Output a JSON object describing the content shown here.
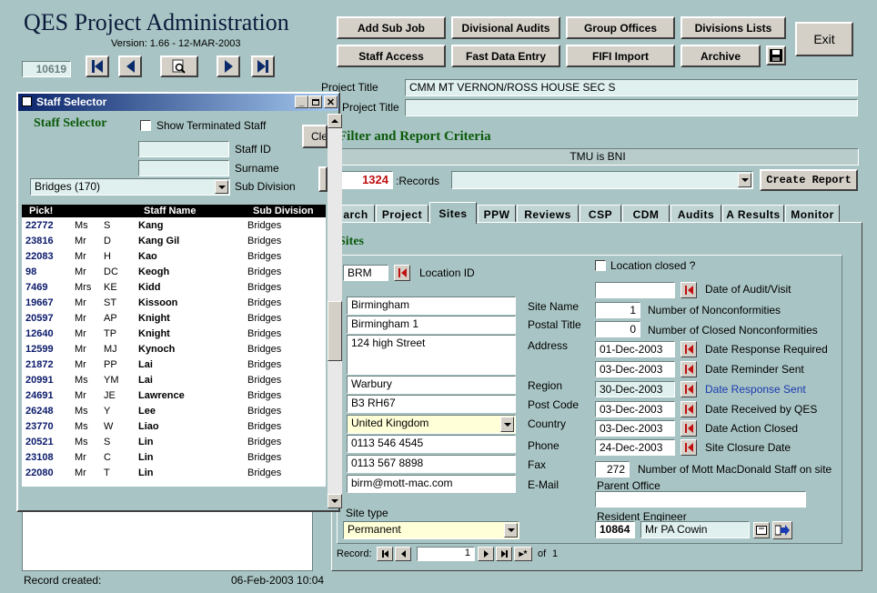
{
  "app": {
    "title": "QES Project Administration",
    "version": "Version: 1.66 - 12-MAR-2003",
    "record_no": "10619"
  },
  "toolbar": {
    "add_sub_job": "Add Sub Job",
    "divisional_audits": "Divisional Audits",
    "group_offices": "Group Offices",
    "divisions_lists": "Divisions Lists",
    "exit": "Exit",
    "staff_access": "Staff Access",
    "fast_data_entry": "Fast Data Entry",
    "fifi_import": "FIFI Import",
    "archive": "Archive"
  },
  "project": {
    "title_label": "Project Title",
    "title_value": "CMM MT VERNON/ROSS HOUSE SEC S",
    "sub_title_label": "Project Title",
    "sub_title_value": ""
  },
  "filter": {
    "heading": "Filter and Report Criteria",
    "criteria": "TMU is BNI",
    "records_count": "1324",
    "records_label": ":Records",
    "create_report": "Create Report"
  },
  "tabs": [
    "arch",
    "Project",
    "Sites",
    "PPW",
    "Reviews",
    "CSP",
    "CDM",
    "Audits",
    "A Results",
    "Monitor"
  ],
  "sites": {
    "heading": "Sites",
    "location_id_value": "BRM",
    "location_id_label": "Location ID",
    "location_closed_label": "Location closed ?",
    "site_name": "Birmingham",
    "postal_title": "Birmingham 1",
    "address": "124 high Street",
    "region": "Warbury",
    "post_code": "B3 RH67",
    "country": "United Kingdom",
    "phone": "0113 546 4545",
    "fax": "0113 567 8898",
    "email": "birm@mott-mac.com",
    "labels": {
      "site_name": "Site Name",
      "postal_title": "Postal Title",
      "address": "Address",
      "region": "Region",
      "post_code": "Post Code",
      "country": "Country",
      "phone": "Phone",
      "fax": "Fax",
      "email": "E-Mail",
      "site_type": "Site type",
      "parent_office": "Parent Office",
      "resident_engineer": "Resident Engineer"
    },
    "site_type": "Permanent",
    "date_audit_label": "Date of Audit/Visit",
    "date_audit_value": "",
    "nonconf_value": "1",
    "nonconf_label": "Number of Nonconformities",
    "closed_nonconf_value": "0",
    "closed_nonconf_label": "Number of Closed Nonconformities",
    "dates": [
      {
        "value": "01-Dec-2003",
        "label": "Date Response Required"
      },
      {
        "value": "03-Dec-2003",
        "label": "Date Reminder Sent"
      },
      {
        "value": "30-Dec-2003",
        "label": "Date Response Sent"
      },
      {
        "value": "03-Dec-2003",
        "label": "Date Received by QES"
      },
      {
        "value": "03-Dec-2003",
        "label": "Date Action Closed"
      },
      {
        "value": "24-Dec-2003",
        "label": "Site Closure Date"
      }
    ],
    "staff_count": "272",
    "staff_count_label": "Number of Mott MacDonald Staff on site",
    "parent_office_value": "",
    "resident_engineer_id": "10864",
    "resident_engineer_name": "Mr PA Cowin"
  },
  "record_nav": {
    "label": "Record:",
    "current": "1",
    "of_label": "of",
    "total": "1"
  },
  "footer": {
    "created_label": "Record created:",
    "created_value": "06-Feb-2003 10:04"
  },
  "staff_selector": {
    "window_title": "Staff Selector",
    "heading": "Staff Selector",
    "show_terminated": "Show Terminated Staff",
    "clear": "Clear",
    "staff_id_label": "Staff ID",
    "surname_label": "Surname",
    "sub_division_label": "Sub Division",
    "division_value": "Bridges (170)",
    "columns": {
      "pick": "Pick!",
      "name": "Staff Name",
      "sub": "Sub Division"
    },
    "rows": [
      {
        "id": "22772",
        "title": "Ms",
        "init": "S",
        "name": "Kang",
        "div": "Bridges"
      },
      {
        "id": "23816",
        "title": "Mr",
        "init": "D",
        "name": "Kang Gil",
        "div": "Bridges"
      },
      {
        "id": "22083",
        "title": "Mr",
        "init": "H",
        "name": "Kao",
        "div": "Bridges"
      },
      {
        "id": "98",
        "title": "Mr",
        "init": "DC",
        "name": "Keogh",
        "div": "Bridges"
      },
      {
        "id": "7469",
        "title": "Mrs",
        "init": "KE",
        "name": "Kidd",
        "div": "Bridges"
      },
      {
        "id": "19667",
        "title": "Mr",
        "init": "ST",
        "name": "Kissoon",
        "div": "Bridges"
      },
      {
        "id": "20597",
        "title": "Mr",
        "init": "AP",
        "name": "Knight",
        "div": "Bridges"
      },
      {
        "id": "12640",
        "title": "Mr",
        "init": "TP",
        "name": "Knight",
        "div": "Bridges"
      },
      {
        "id": "12599",
        "title": "Mr",
        "init": "MJ",
        "name": "Kynoch",
        "div": "Bridges"
      },
      {
        "id": "21872",
        "title": "Mr",
        "init": "PP",
        "name": "Lai",
        "div": "Bridges"
      },
      {
        "id": "20991",
        "title": "Ms",
        "init": "YM",
        "name": "Lai",
        "div": "Bridges"
      },
      {
        "id": "24691",
        "title": "Mr",
        "init": "JE",
        "name": "Lawrence",
        "div": "Bridges"
      },
      {
        "id": "26248",
        "title": "Ms",
        "init": "Y",
        "name": "Lee",
        "div": "Bridges"
      },
      {
        "id": "23770",
        "title": "Ms",
        "init": "W",
        "name": "Liao",
        "div": "Bridges"
      },
      {
        "id": "20521",
        "title": "Ms",
        "init": "S",
        "name": "Lin",
        "div": "Bridges"
      },
      {
        "id": "23108",
        "title": "Mr",
        "init": "C",
        "name": "Lin",
        "div": "Bridges"
      },
      {
        "id": "22080",
        "title": "Mr",
        "init": "T",
        "name": "Lin",
        "div": "Bridges"
      }
    ]
  }
}
